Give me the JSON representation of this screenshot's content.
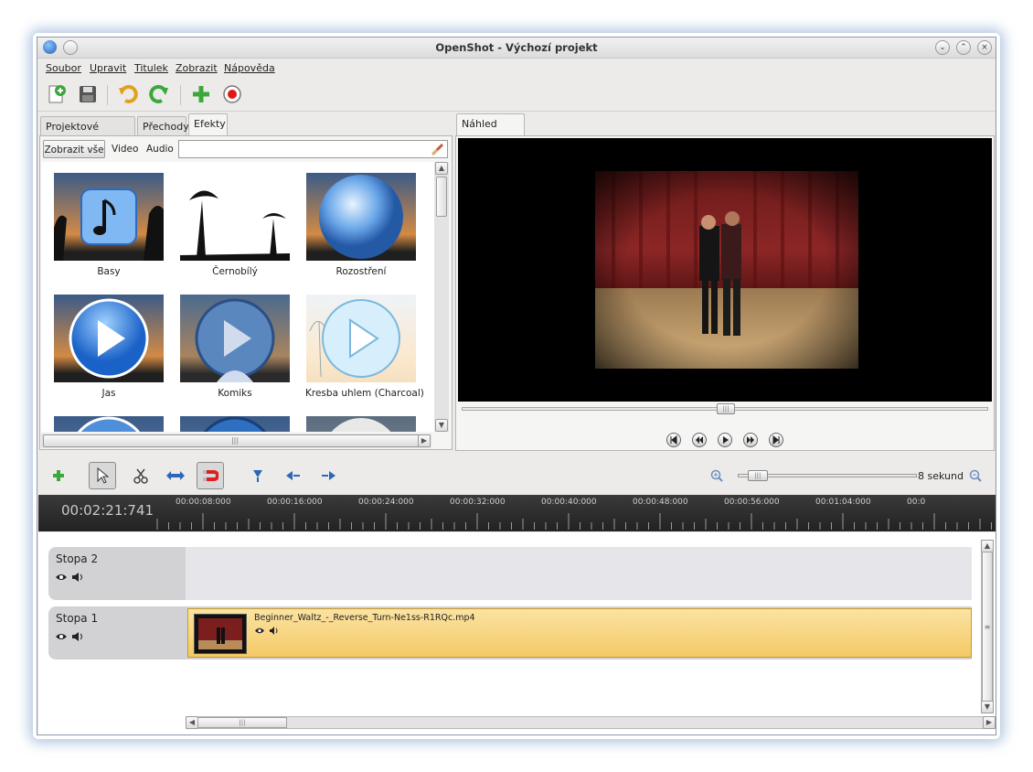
{
  "window": {
    "title": "OpenShot - Výchozí projekt"
  },
  "menu": [
    "Soubor",
    "Upravit",
    "Titulek",
    "Zobrazit",
    "Nápověda"
  ],
  "toolbar": [
    "new-project-icon",
    "save-icon",
    "undo-icon",
    "redo-icon",
    "add-file-icon",
    "record-icon"
  ],
  "left_tabs": [
    "Projektové soubory",
    "Přechody",
    "Efekty"
  ],
  "filter": {
    "buttons": [
      "Zobrazit vše",
      "Video",
      "Audio"
    ],
    "search_value": ""
  },
  "effects": [
    "Basy",
    "Černobílý",
    "Rozostření",
    "Jas",
    "Komiks",
    "Kresba uhlem (Charcoal)"
  ],
  "preview": {
    "tab": "Náhled videa",
    "progress": 0.5
  },
  "timeline": {
    "time": "00:02:21:741",
    "zoom_label": "8 sekund",
    "zoom_level": 0.05,
    "ruler": [
      "00:00:08:000",
      "00:00:16:000",
      "00:00:24:000",
      "00:00:32:000",
      "00:00:40:000",
      "00:00:48:000",
      "00:00:56:000",
      "00:01:04:000",
      "00:0"
    ],
    "tracks": [
      {
        "name": "Stopa 2",
        "clip": ""
      },
      {
        "name": "Stopa 1",
        "clip": "Beginner_Waltz_-_Reverse_Turn-Ne1ss-R1RQc.mp4"
      }
    ]
  },
  "colors": {
    "clip_fill": "#f7d27a",
    "track_bg": "#d2d2d4",
    "ruler_bg": "#2a2a2a",
    "accent_green": "#3aa83a"
  }
}
